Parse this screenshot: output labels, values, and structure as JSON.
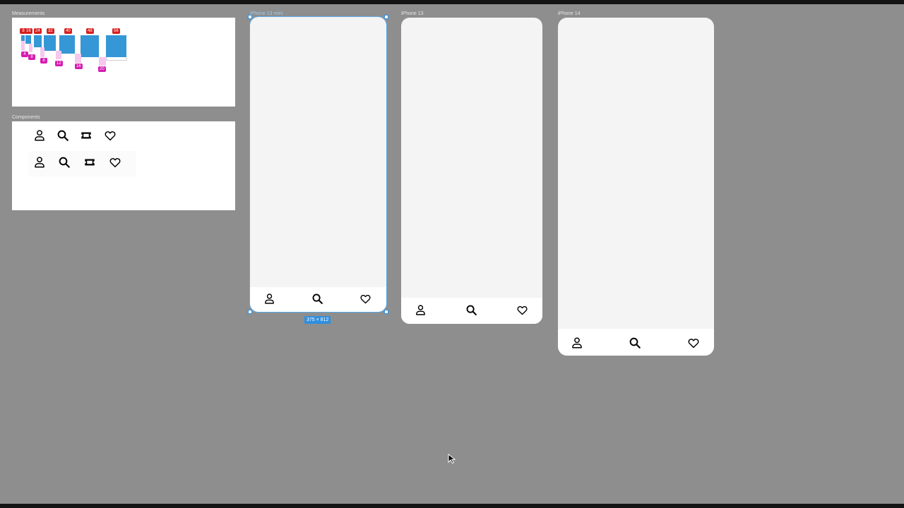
{
  "frames": {
    "measurements": {
      "label": "Measurements"
    },
    "components": {
      "label": "Components"
    },
    "phone_mini": {
      "label": "iPhone 13 mini",
      "size": "375 × 812"
    },
    "phone_13": {
      "label": "iPhone 13"
    },
    "phone_14": {
      "label": "iPhone 14"
    }
  },
  "measurements": {
    "sizes": [
      "8",
      "16",
      "24",
      "32",
      "40",
      "48",
      "56"
    ],
    "spacings": [
      "4",
      "8",
      "8",
      "12",
      "16",
      "20"
    ]
  },
  "components": {
    "row1": [
      "person-icon",
      "search-icon",
      "ticket-icon",
      "heart-icon"
    ],
    "row2": [
      "person-icon",
      "search-icon",
      "ticket-icon",
      "heart-icon"
    ]
  },
  "tabbar": {
    "tabs": [
      "person-icon",
      "search-icon",
      "heart-icon"
    ]
  },
  "colors": {
    "canvas": "#8e8e8e",
    "selection": "#2f8fe0",
    "measure_red": "#d61f1f",
    "measure_pink": "#d51bb0",
    "measure_blue": "#3597d6"
  }
}
